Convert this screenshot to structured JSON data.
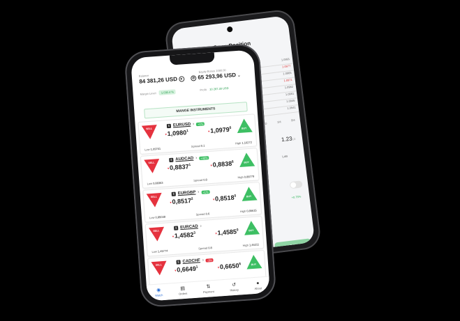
{
  "back_phone": {
    "title": "Open Position",
    "levels": [
      "1.0991",
      "1.0977",
      "1.0965",
      "1.0971",
      "1.0982",
      "1.0951",
      "1.0946",
      "1.0941"
    ],
    "tabs": [
      "2D",
      "1M",
      "5M"
    ],
    "price_main": "1.23",
    "price_sup": "13",
    "label": "Lots",
    "pct": "+0.75%",
    "button_label": "BUY"
  },
  "account": {
    "balance_label": "Balance",
    "balance_value": "84 381,26 USD",
    "margin_label": "Margin Level",
    "margin_value": "1.030.4 %",
    "equity_label": "Equity Bonus 1080.00",
    "equity_value": "65 293,96 USD",
    "profit_label": "Profit",
    "profit_value": "10 287.30 USD"
  },
  "manage_label": "MANGE INSTRUMENTS",
  "sell_label": "SELL",
  "buy_label": "BUY",
  "instruments": [
    {
      "symbol": "EURUSD",
      "change": "+1%",
      "dir": "up",
      "sell_main": "1,0980",
      "sell_sup": "1",
      "buy_main": "1,0979",
      "buy_sup": "6",
      "low_label": "Low",
      "low": "1,09761",
      "spread_label": "Spread",
      "spread": "0.1",
      "high_label": "High",
      "high": "1,10272"
    },
    {
      "symbol": "AUDCAD",
      "change": "+40%",
      "dir": "up",
      "sell_main": "0,8837",
      "sell_sup": "1",
      "buy_main": "0,8838",
      "buy_sup": "6",
      "low_label": "Low",
      "low": "0,88363",
      "spread_label": "Spread",
      "spread": "0.8",
      "high_label": "High",
      "high": "0,88779"
    },
    {
      "symbol": "EURGBP",
      "change": "+1%",
      "dir": "up",
      "sell_main": "0,8517",
      "sell_sup": "2",
      "buy_main": "0,8518",
      "buy_sup": "0",
      "low_label": "Low",
      "low": "0,85038",
      "spread_label": "Spread",
      "spread": "0.6",
      "high_label": "High",
      "high": "0,85615"
    },
    {
      "symbol": "EURCAD",
      "change": "",
      "dir": "up",
      "sell_main": "1,4582",
      "sell_sup": "3",
      "buy_main": "1,4585",
      "buy_sup": "0",
      "low_label": "Low",
      "low": "1,45774",
      "spread_label": "Spread",
      "spread": "0.8",
      "high_label": "High",
      "high": "1,46211"
    },
    {
      "symbol": "CADCHF",
      "change": "-3%",
      "dir": "down",
      "sell_main": "0,6649",
      "sell_sup": "1",
      "buy_main": "0,6650",
      "buy_sup": "6",
      "low_label": "",
      "low": "",
      "spread_label": "",
      "spread": "",
      "high_label": "",
      "high": ""
    }
  ],
  "nav": [
    {
      "label": "Watch",
      "icon": "eye-icon",
      "glyph": "◉"
    },
    {
      "label": "Orders",
      "icon": "orders-icon",
      "glyph": "▤"
    },
    {
      "label": "Payment",
      "icon": "transfer-icon",
      "glyph": "⇅"
    },
    {
      "label": "History",
      "icon": "history-icon",
      "glyph": "↺"
    },
    {
      "label": "About",
      "icon": "user-icon",
      "glyph": "●"
    }
  ],
  "colors": {
    "sell": "#e5323e",
    "buy": "#3dbf63",
    "active_nav": "#2b6fd6"
  }
}
